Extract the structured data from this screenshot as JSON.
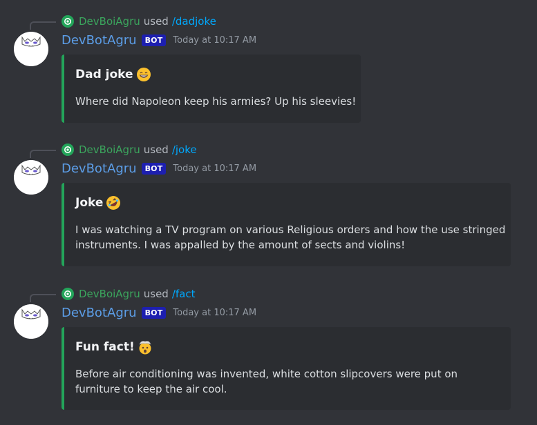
{
  "colors": {
    "background": "#313338",
    "embed_background": "#2b2d31",
    "embed_accent": "#23a55a",
    "username": "#5c9ee8",
    "invoker": "#3ba55d",
    "command": "#00a8fc",
    "bot_tag": "#1d1fb0"
  },
  "messages": [
    {
      "invoker": "DevBoiAgru",
      "used": "used",
      "command": "/dadjoke",
      "author": "DevBotAgru",
      "bot_tag": "BOT",
      "timestamp": "Today at 10:17 AM",
      "embed": {
        "title": "Dad joke",
        "emoji": "grinning-face-icon",
        "lines": [
          "Where did Napoleon keep his armies? Up his sleevies!"
        ]
      }
    },
    {
      "invoker": "DevBoiAgru",
      "used": "used",
      "command": "/joke",
      "author": "DevBotAgru",
      "bot_tag": "BOT",
      "timestamp": "Today at 10:17 AM",
      "embed": {
        "title": "Joke",
        "emoji": "rolling-laughing-icon",
        "lines": [
          "I was watching a TV program on various Religious orders and how the use stringed",
          "instruments. I was appalled by the amount of sects and violins!"
        ]
      }
    },
    {
      "invoker": "DevBoiAgru",
      "used": "used",
      "command": "/fact",
      "author": "DevBotAgru",
      "bot_tag": "BOT",
      "timestamp": "Today at 10:17 AM",
      "embed": {
        "title": "Fun fact!",
        "emoji": "exploding-head-icon",
        "lines": [
          "Before air conditioning was invented, white cotton slipcovers were put on",
          "furniture to keep the air cool."
        ]
      }
    }
  ]
}
